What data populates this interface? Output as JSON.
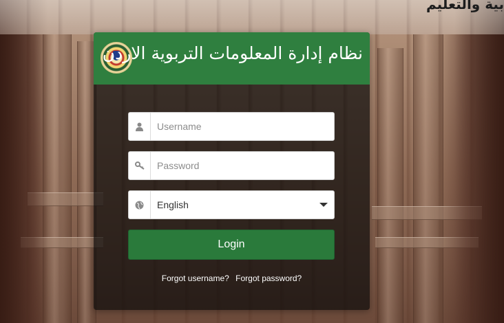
{
  "header": {
    "top_title": "بية والتعليم"
  },
  "panel": {
    "title": "نظام إدارة المعلومات التربوية الاردن",
    "emblem_icon": "jordan-coat-of-arms"
  },
  "form": {
    "username": {
      "placeholder": "Username",
      "value": "",
      "icon": "user-icon"
    },
    "password": {
      "placeholder": "Password",
      "value": "",
      "icon": "key-icon"
    },
    "language": {
      "selected": "English",
      "icon": "globe-icon"
    },
    "login_label": "Login"
  },
  "links": {
    "forgot_username": "Forgot username?",
    "forgot_password": "Forgot password?"
  },
  "colors": {
    "header_green": "#2f7f3f",
    "button_green": "#2a7a3b",
    "panel_overlay": "rgba(8,8,8,0.68)"
  }
}
